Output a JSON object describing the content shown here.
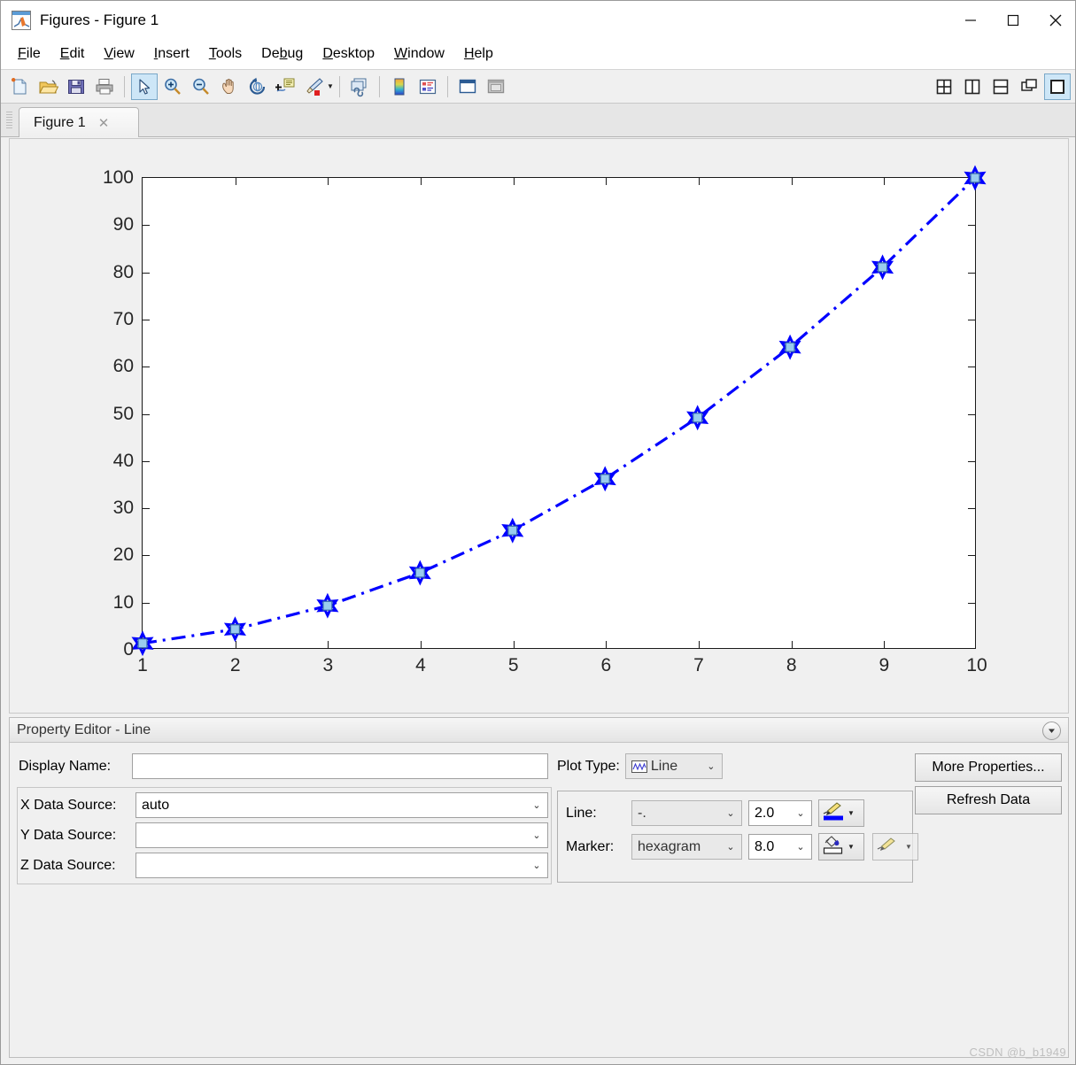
{
  "window": {
    "title": "Figures - Figure 1",
    "app_icon": "matlab-icon",
    "minimize": "minimize-icon",
    "maximize": "maximize-icon",
    "close": "close-icon"
  },
  "menubar": {
    "items": [
      {
        "label": "File",
        "mnemonic": "F"
      },
      {
        "label": "Edit",
        "mnemonic": "E"
      },
      {
        "label": "View",
        "mnemonic": "V"
      },
      {
        "label": "Insert",
        "mnemonic": "I"
      },
      {
        "label": "Tools",
        "mnemonic": "T"
      },
      {
        "label": "Debug",
        "mnemonic": "b"
      },
      {
        "label": "Desktop",
        "mnemonic": "D"
      },
      {
        "label": "Window",
        "mnemonic": "W"
      },
      {
        "label": "Help",
        "mnemonic": "H"
      }
    ],
    "dock_icons": [
      "minimize-panel-icon",
      "undock-icon",
      "close-panel-icon"
    ]
  },
  "toolbar": {
    "icons": [
      "new-figure-icon",
      "open-file-icon",
      "save-figure-icon",
      "print-figure-icon",
      "edit-plot-arrow-icon",
      "zoom-in-icon",
      "zoom-out-icon",
      "pan-icon",
      "rotate-3d-icon",
      "data-cursor-icon",
      "brush-icon",
      "link-data-icon",
      "colorbar-icon",
      "legend-icon",
      "hide-plot-tools-icon",
      "show-plot-tools-icon"
    ],
    "selected_icon": "edit-plot-arrow-icon",
    "layout_icons": [
      "tile-grid-icon",
      "tile-vertical-icon",
      "tile-horizontal-icon",
      "cascade-icon",
      "single-pane-icon"
    ],
    "layout_selected": "single-pane-icon"
  },
  "tabs": {
    "items": [
      {
        "label": "Figure 1",
        "close": "close-tab-icon",
        "active": true
      }
    ]
  },
  "chart_data": {
    "type": "line",
    "title": "",
    "xlabel": "",
    "ylabel": "",
    "x": [
      1,
      2,
      3,
      4,
      5,
      6,
      7,
      8,
      9,
      10
    ],
    "y": [
      1,
      4,
      9,
      16,
      25,
      36,
      49,
      64,
      81,
      100
    ],
    "series": [
      {
        "name": "Line",
        "values": [
          1,
          4,
          9,
          16,
          25,
          36,
          49,
          64,
          81,
          100
        ]
      }
    ],
    "xlim": [
      1,
      10
    ],
    "ylim": [
      0,
      100
    ],
    "xticks": [
      1,
      2,
      3,
      4,
      5,
      6,
      7,
      8,
      9,
      10
    ],
    "yticks": [
      0,
      10,
      20,
      30,
      40,
      50,
      60,
      70,
      80,
      90,
      100
    ],
    "xticklabels": [
      "1",
      "2",
      "3",
      "4",
      "5",
      "6",
      "7",
      "8",
      "9",
      "10"
    ],
    "yticklabels": [
      "0",
      "10",
      "20",
      "30",
      "40",
      "50",
      "60",
      "70",
      "80",
      "90",
      "100"
    ],
    "grid": false,
    "legend": null,
    "line_color": "#0000ff",
    "line_style": "-.",
    "line_width": 2.0,
    "marker": "hexagram",
    "marker_size": 8.0,
    "selected": true,
    "selection_handle_color": "#99ccee"
  },
  "property_editor": {
    "title": "Property Editor - Line",
    "collapse_icon": "collapse-panel-icon",
    "display_name": {
      "label": "Display Name:",
      "value": "",
      "placeholder": ""
    },
    "data_sources": [
      {
        "label": "X Data Source:",
        "value": "auto"
      },
      {
        "label": "Y Data Source:",
        "value": ""
      },
      {
        "label": "Z Data Source:",
        "value": ""
      }
    ],
    "plot_type": {
      "label": "Plot Type:",
      "value": "Line",
      "icon": "line-plot-icon"
    },
    "line": {
      "label": "Line:",
      "style": "-.",
      "width": "2.0",
      "color_swatch": "#0000ff",
      "color_icon": "line-color-pencil-icon"
    },
    "marker": {
      "label": "Marker:",
      "shape": "hexagram",
      "size": "8.0",
      "face_color_swatch": "#ffffff",
      "face_icon": "paint-bucket-icon",
      "edge_icon": "marker-edge-pencil-icon"
    },
    "buttons": [
      {
        "label": "More Properties...",
        "name": "more-properties-button"
      },
      {
        "label": "Refresh Data",
        "name": "refresh-data-button"
      }
    ]
  },
  "watermark": "CSDN @b_b1949"
}
